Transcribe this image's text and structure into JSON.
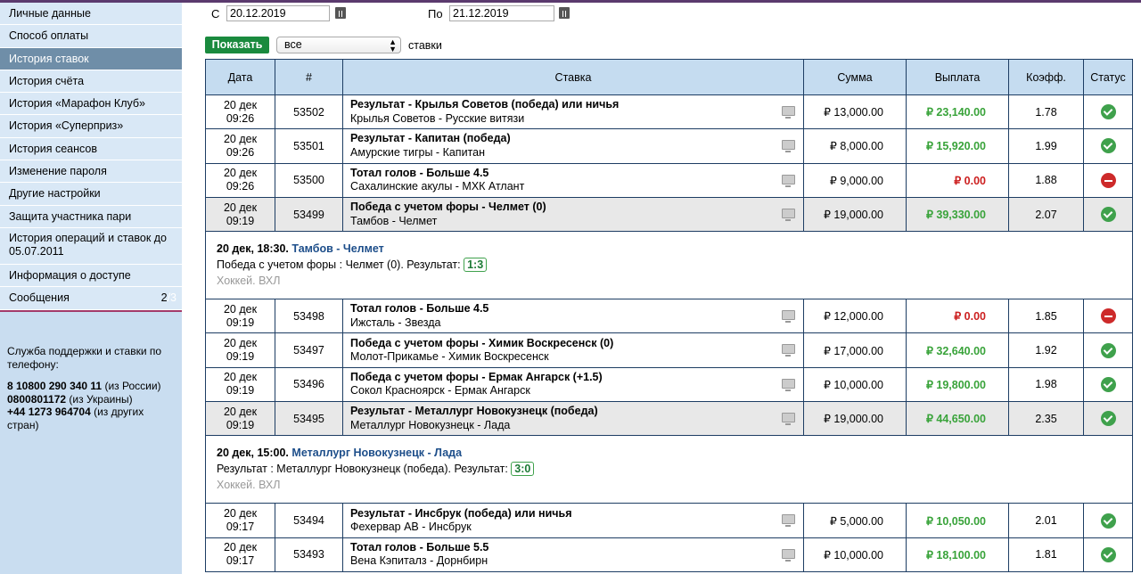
{
  "sidebar": {
    "items": [
      {
        "label": "Личные данные",
        "active": false
      },
      {
        "label": "Способ оплаты",
        "active": false
      },
      {
        "label": "История ставок",
        "active": true
      },
      {
        "label": "История счёта",
        "active": false
      },
      {
        "label": "История «Марафон Клуб»",
        "active": false
      },
      {
        "label": "История «Суперприз»",
        "active": false
      },
      {
        "label": "История сеансов",
        "active": false
      },
      {
        "label": "Изменение пароля",
        "active": false
      },
      {
        "label": "Другие настройки",
        "active": false
      },
      {
        "label": "Защита участника пари",
        "active": false
      },
      {
        "label": "История операций и ставок до 05.07.2011",
        "active": false
      },
      {
        "label": "Информация о доступе",
        "active": false
      },
      {
        "label": "Сообщения",
        "active": false,
        "count": "2",
        "count_extra": "/3"
      }
    ],
    "support": {
      "title": "Служба поддержки и ставки по телефону:",
      "lines": [
        {
          "phone": "8 10800 290 340 11",
          "note": " (из России)"
        },
        {
          "phone": "0800801172",
          "note": " (из Украины)"
        },
        {
          "phone": "+44 1273 964704",
          "note": " (из других стран)"
        }
      ]
    }
  },
  "filters": {
    "from_label": "С",
    "from_value": "20.12.2019",
    "to_label": "По",
    "to_value": "21.12.2019",
    "show_button": "Показать",
    "select_value": "все",
    "select_suffix": "ставки"
  },
  "table": {
    "headers": [
      "Дата",
      "#",
      "Ставка",
      "Сумма",
      "Выплата",
      "Коэфф.",
      "Статус"
    ],
    "rows": [
      {
        "kind": "bet",
        "date": "20 дек",
        "time": "09:26",
        "num": "53502",
        "title": "Результат - Крылья Советов (победа) или ничья",
        "match": "Крылья Советов - Русские витязи",
        "sum": "₽ 13,000.00",
        "pay": "₽ 23,140.00",
        "win": true,
        "k": "1.78",
        "grey": false
      },
      {
        "kind": "bet",
        "date": "20 дек",
        "time": "09:26",
        "num": "53501",
        "title": "Результат - Капитан (победа)",
        "match": "Амурские тигры - Капитан",
        "sum": "₽ 8,000.00",
        "pay": "₽ 15,920.00",
        "win": true,
        "k": "1.99",
        "grey": false
      },
      {
        "kind": "bet",
        "date": "20 дек",
        "time": "09:26",
        "num": "53500",
        "title": "Тотал голов - Больше 4.5",
        "match": "Сахалинские акулы - МХК Атлант",
        "sum": "₽ 9,000.00",
        "pay": "₽ 0.00",
        "win": false,
        "k": "1.88",
        "grey": false
      },
      {
        "kind": "bet",
        "date": "20 дек",
        "time": "09:19",
        "num": "53499",
        "title": "Победа с учетом форы - Челмет (0)",
        "match": "Тамбов - Челмет",
        "sum": "₽ 19,000.00",
        "pay": "₽ 39,330.00",
        "win": true,
        "k": "2.07",
        "grey": true
      },
      {
        "kind": "info",
        "datetime": "20 дек, 18:30.",
        "event": "Тамбов - Челмет",
        "desc": "Победа с учетом форы : Челмет (0). Результат:",
        "result": "1:3",
        "league": "Хоккей. ВХЛ"
      },
      {
        "kind": "bet",
        "date": "20 дек",
        "time": "09:19",
        "num": "53498",
        "title": "Тотал голов - Больше 4.5",
        "match": "Ижсталь - Звезда",
        "sum": "₽ 12,000.00",
        "pay": "₽ 0.00",
        "win": false,
        "k": "1.85",
        "grey": false
      },
      {
        "kind": "bet",
        "date": "20 дек",
        "time": "09:19",
        "num": "53497",
        "title": "Победа с учетом форы - Химик Воскресенск (0)",
        "match": "Молот-Прикамье - Химик Воскресенск",
        "sum": "₽ 17,000.00",
        "pay": "₽ 32,640.00",
        "win": true,
        "k": "1.92",
        "grey": false
      },
      {
        "kind": "bet",
        "date": "20 дек",
        "time": "09:19",
        "num": "53496",
        "title": "Победа с учетом форы - Ермак Ангарск (+1.5)",
        "match": "Сокол Красноярск - Ермак Ангарск",
        "sum": "₽ 10,000.00",
        "pay": "₽ 19,800.00",
        "win": true,
        "k": "1.98",
        "grey": false
      },
      {
        "kind": "bet",
        "date": "20 дек",
        "time": "09:19",
        "num": "53495",
        "title": "Результат - Металлург Новокузнецк (победа)",
        "match": "Металлург Новокузнецк - Лада",
        "sum": "₽ 19,000.00",
        "pay": "₽ 44,650.00",
        "win": true,
        "k": "2.35",
        "grey": true
      },
      {
        "kind": "info",
        "datetime": "20 дек, 15:00.",
        "event": "Металлург Новокузнецк - Лада",
        "desc": "Результат : Металлург Новокузнецк (победа). Результат:",
        "result": "3:0",
        "league": "Хоккей. ВХЛ"
      },
      {
        "kind": "bet",
        "date": "20 дек",
        "time": "09:17",
        "num": "53494",
        "title": "Результат - Инсбрук (победа) или ничья",
        "match": "Фехервар АВ - Инсбрук",
        "sum": "₽ 5,000.00",
        "pay": "₽ 10,050.00",
        "win": true,
        "k": "2.01",
        "grey": false
      },
      {
        "kind": "bet",
        "date": "20 дек",
        "time": "09:17",
        "num": "53493",
        "title": "Тотал голов - Больше 5.5",
        "match": "Вена Кэпиталз - Дорнбирн",
        "sum": "₽ 10,000.00",
        "pay": "₽ 18,100.00",
        "win": true,
        "k": "1.81",
        "grey": false
      }
    ]
  }
}
